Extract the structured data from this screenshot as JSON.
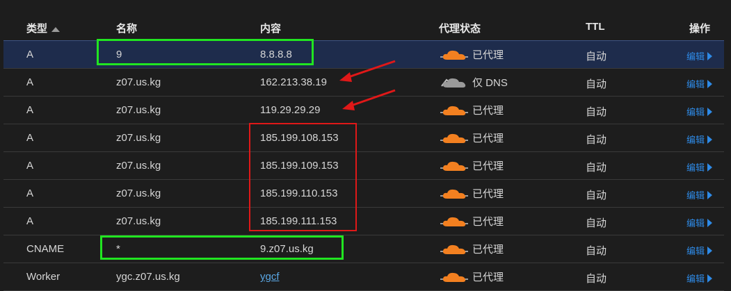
{
  "header": {
    "type": "类型",
    "name": "名称",
    "content": "内容",
    "proxy": "代理状态",
    "ttl": "TTL",
    "actions": "操作"
  },
  "rows": [
    {
      "type": "A",
      "name": "9",
      "content": "8.8.8.8",
      "proxy_icon": "cloud-proxied-icon",
      "proxy": "已代理",
      "ttl": "自动",
      "edit": "编辑"
    },
    {
      "type": "A",
      "name": "z07.us.kg",
      "content": "162.213.38.19",
      "proxy_icon": "cloud-dns-only-icon",
      "proxy": "仅 DNS",
      "ttl": "自动",
      "edit": "编辑"
    },
    {
      "type": "A",
      "name": "z07.us.kg",
      "content": "119.29.29.29",
      "proxy_icon": "cloud-proxied-icon",
      "proxy": "已代理",
      "ttl": "自动",
      "edit": "编辑"
    },
    {
      "type": "A",
      "name": "z07.us.kg",
      "content": "185.199.108.153",
      "proxy_icon": "cloud-proxied-icon",
      "proxy": "已代理",
      "ttl": "自动",
      "edit": "编辑"
    },
    {
      "type": "A",
      "name": "z07.us.kg",
      "content": "185.199.109.153",
      "proxy_icon": "cloud-proxied-icon",
      "proxy": "已代理",
      "ttl": "自动",
      "edit": "编辑"
    },
    {
      "type": "A",
      "name": "z07.us.kg",
      "content": "185.199.110.153",
      "proxy_icon": "cloud-proxied-icon",
      "proxy": "已代理",
      "ttl": "自动",
      "edit": "编辑"
    },
    {
      "type": "A",
      "name": "z07.us.kg",
      "content": "185.199.111.153",
      "proxy_icon": "cloud-proxied-icon",
      "proxy": "已代理",
      "ttl": "自动",
      "edit": "编辑"
    },
    {
      "type": "CNAME",
      "name": "*",
      "content": "9.z07.us.kg",
      "proxy_icon": "cloud-proxied-icon",
      "proxy": "已代理",
      "ttl": "自动",
      "edit": "编辑"
    },
    {
      "type": "Worker",
      "name": "ygc.z07.us.kg",
      "content": "ygcf",
      "proxy_icon": "cloud-proxied-icon",
      "proxy": "已代理",
      "ttl": "自动",
      "edit": "编辑"
    }
  ],
  "colors": {
    "background": "#1d1d1d",
    "selected_row": "#1e2c4c",
    "proxied_cloud": "#f38020",
    "dns_only_cloud": "#9a9a9a",
    "link": "#2e8ae6",
    "highlight_green": "#21e521",
    "highlight_red": "#e01818"
  }
}
